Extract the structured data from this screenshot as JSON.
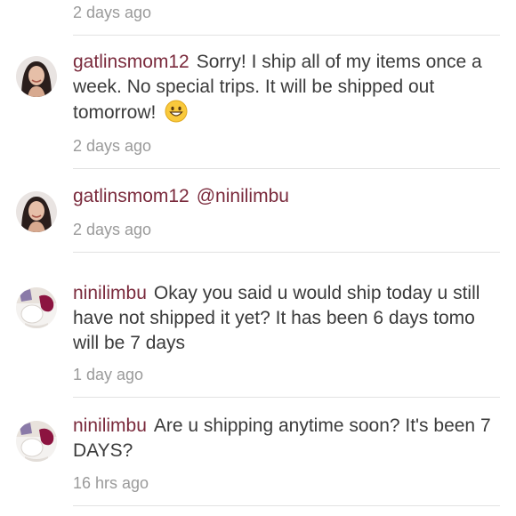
{
  "comments": [
    {
      "time": "2 days ago"
    },
    {
      "username": "gatlinsmom12",
      "text": "Sorry! I ship all of my items once a week. No special trips. It will be shipped out tomorrow!",
      "emoji": "grinning-face-emoji",
      "time": "2 days ago"
    },
    {
      "username": "gatlinsmom12",
      "mention": "@ninilimbu",
      "time": "2 days ago"
    },
    {
      "username": "ninilimbu",
      "text": "Okay you said u would ship today u still have not shipped it yet? It has been 6 days tomo will be 7 days",
      "time": "1 day ago"
    },
    {
      "username": "ninilimbu",
      "text": "Are u shipping anytime soon? It's been 7 DAYS?",
      "time": "16 hrs ago"
    }
  ],
  "colors": {
    "username": "#7a2a3c",
    "body_text": "#3b3b3b",
    "timestamp": "#9a9a9a",
    "divider": "#e2e2e2"
  }
}
